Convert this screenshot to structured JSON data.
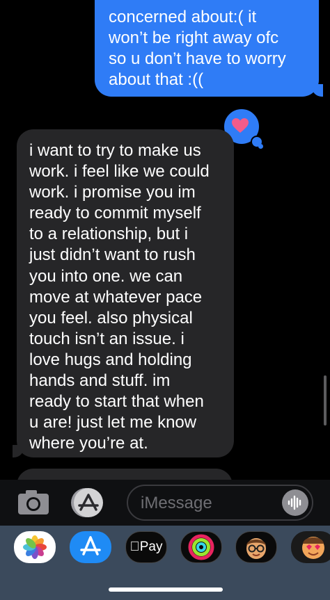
{
  "conversation": {
    "sent_message": {
      "text": "concerned about:( it\nwon’t be right away ofc\nso u don’t have to worry\nabout that :((",
      "color": "#2f7cf6"
    },
    "tapback": {
      "icon": "heart-icon",
      "color": "#f25c8a"
    },
    "received_message": {
      "text": "i want to try to make us\nwork. i feel like we could\nwork. i promise you im\nready to commit myself\nto a relationship, but i\njust didn’t want to rush\nyou into one. we can\nmove at whatever pace\nyou feel. also physical\ntouch isn’t an issue. i\nlove hugs and holding\nhands and stuff. im\nready to start that when\nu are! just let me know\nwhere you’re at.",
      "color": "#262628"
    }
  },
  "composer": {
    "placeholder": "iMessage",
    "camera_icon": "camera-icon",
    "apps_icon": "app-store-icon",
    "audio_icon": "audio-waveform-icon"
  },
  "app_tray": {
    "items": [
      {
        "name": "Photos",
        "icon": "photos-icon"
      },
      {
        "name": "App Store",
        "icon": "app-store-icon"
      },
      {
        "name": "Apple Pay",
        "label": "Pay",
        "icon": "apple-logo-icon"
      },
      {
        "name": "Fitness",
        "icon": "activity-rings-icon"
      },
      {
        "name": "Memoji",
        "icon": "memoji-icon"
      },
      {
        "name": "Memoji Stickers",
        "icon": "sticker-icon"
      }
    ]
  }
}
